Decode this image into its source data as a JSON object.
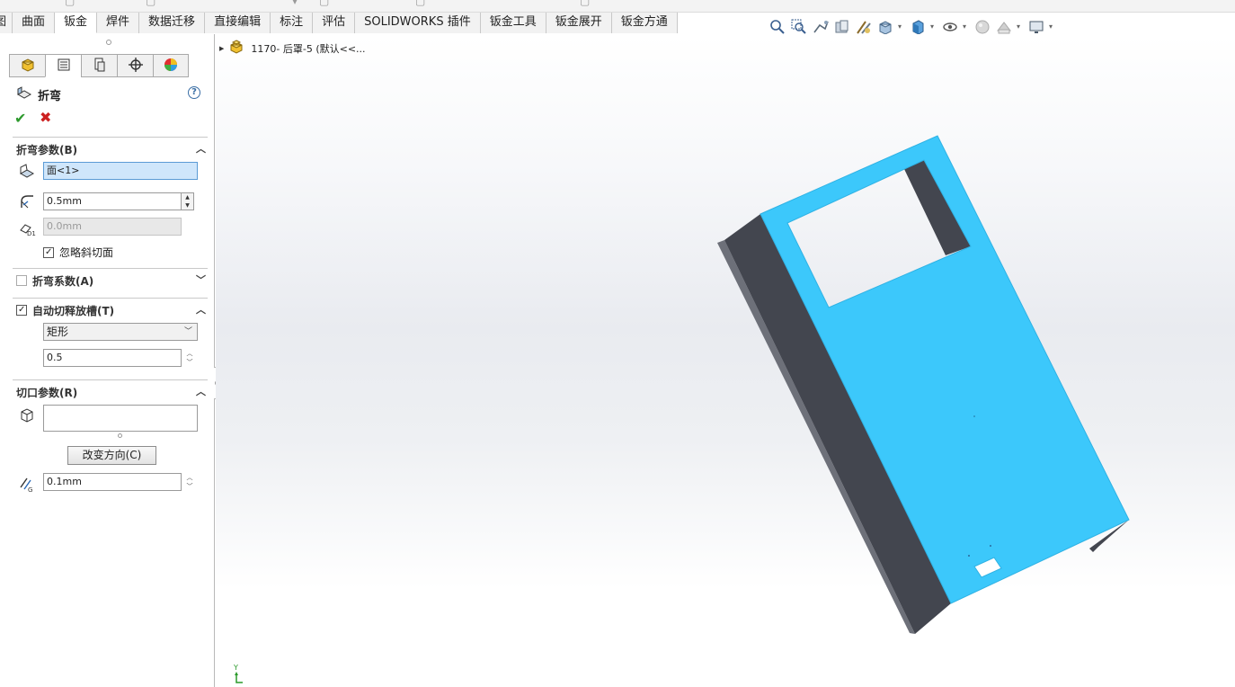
{
  "ribbon_tabs": [
    "图",
    "曲面",
    "钣金",
    "焊件",
    "数据迁移",
    "直接编辑",
    "标注",
    "评估",
    "SOLIDWORKS 插件",
    "钣金工具",
    "钣金展开",
    "钣金方通"
  ],
  "active_tab_index": 2,
  "feature_manager_tabs": [
    "feature-tree-icon",
    "property-manager-icon",
    "configuration-icon",
    "dimxpert-icon",
    "appearance-icon"
  ],
  "property_manager": {
    "title": "折弯",
    "sections": {
      "bend_params": {
        "label": "折弯参数(B)",
        "face_value": "面<1>",
        "radius_value": "0.5mm",
        "offset_value": "0.0mm",
        "ignore_bevel_label": "忽略斜切面",
        "ignore_bevel_checked": true
      },
      "bend_allowance": {
        "label": "折弯系数(A)",
        "checked": false
      },
      "auto_relief": {
        "label": "自动切释放槽(T)",
        "checked": true,
        "relief_type": "矩形",
        "ratio_value": "0.5"
      },
      "rip_params": {
        "label": "切口参数(R)",
        "change_direction_label": "改变方向(C)",
        "gap_value": "0.1mm"
      }
    }
  },
  "viewport": {
    "tree_item_label": "1170- 后罩-5  (默认<<...",
    "triad_label": "Y",
    "part_color": "#3cc8fb",
    "flange_color": "#43464f"
  },
  "colors": {
    "accent": "#5b9bd5",
    "ok": "#2e9a2e",
    "cancel": "#cc2020"
  }
}
